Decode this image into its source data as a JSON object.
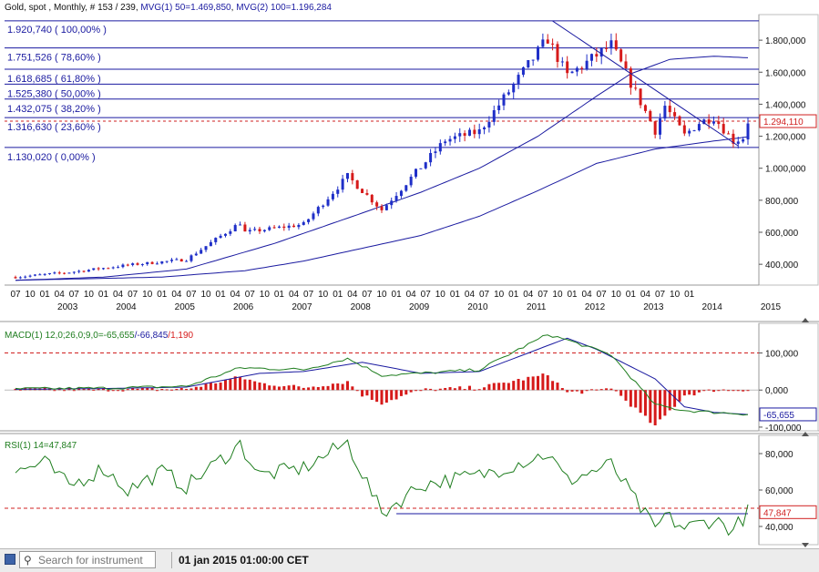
{
  "header": {
    "instrument": "Gold, spot",
    "timeframe": "Monthly",
    "bars": "# 153 / 239",
    "mvg1": "MVG(1) 50=1.469,850",
    "mvg2": "MVG(2) 100=1.196,284"
  },
  "colors": {
    "up_candle": "#1f2fc8",
    "down_candle": "#d61a1a",
    "line_blue": "#1a1aa0",
    "signal_green": "#1e7d1e",
    "hist_red": "#d61a1a",
    "dashed_red": "#d02020"
  },
  "chart_data": [
    {
      "type": "candlestick",
      "name": "price",
      "ylim": [
        270,
        1960
      ],
      "y_ticks": [
        {
          "v": 1800,
          "label": "1.800,000"
        },
        {
          "v": 1600,
          "label": "1.600,000"
        },
        {
          "v": 1400,
          "label": "1.400,000"
        },
        {
          "v": 1200,
          "label": "1.200,000"
        },
        {
          "v": 1000,
          "label": "1.000,000"
        },
        {
          "v": 800,
          "label": "800,000"
        },
        {
          "v": 600,
          "label": "600,000"
        },
        {
          "v": 400,
          "label": "400,000"
        }
      ],
      "last_price": {
        "value": 1294.11,
        "label": "1.294,110"
      },
      "fib_levels": [
        {
          "value": 1920.74,
          "label": "1.920,740 ( 100,00% )"
        },
        {
          "value": 1751.526,
          "label": "1.751,526 ( 78,60% )"
        },
        {
          "value": 1618.685,
          "label": "1.618,685 ( 61,80% )"
        },
        {
          "value": 1525.38,
          "label": "1.525,380 ( 50,00% )"
        },
        {
          "value": 1432.075,
          "label": "1.432,075 ( 38,20% )"
        },
        {
          "value": 1316.63,
          "label": "1.316,630 ( 23,60% )"
        },
        {
          "value": 1130.02,
          "label": "1.130,020 ( 0,00% )"
        }
      ],
      "anchors": [
        [
          "2002-07",
          320
        ],
        [
          "2003-06",
          350
        ],
        [
          "2004-06",
          395
        ],
        [
          "2005-06",
          430
        ],
        [
          "2006-05",
          660
        ],
        [
          "2006-06",
          600
        ],
        [
          "2007-06",
          650
        ],
        [
          "2008-03",
          950
        ],
        [
          "2008-10",
          740
        ],
        [
          "2009-11",
          1175
        ],
        [
          "2010-06",
          1230
        ],
        [
          "2011-08",
          1810
        ],
        [
          "2011-12",
          1575
        ],
        [
          "2012-09",
          1770
        ],
        [
          "2013-06",
          1235
        ],
        [
          "2013-08",
          1390
        ],
        [
          "2013-12",
          1205
        ],
        [
          "2014-03",
          1285
        ],
        [
          "2014-06",
          1320
        ],
        [
          "2014-10",
          1170
        ],
        [
          "2014-12",
          1190
        ],
        [
          "2015-01",
          1294
        ]
      ],
      "trendline": {
        "from": [
          "2011-09",
          1920
        ],
        "to": [
          "2014-11",
          1140
        ]
      },
      "mvg50": [
        [
          "2002-07",
          300
        ],
        [
          "2004-01",
          320
        ],
        [
          "2005-06",
          370
        ],
        [
          "2006-12",
          530
        ],
        [
          "2008-06",
          720
        ],
        [
          "2009-06",
          850
        ],
        [
          "2010-06",
          1000
        ],
        [
          "2011-06",
          1200
        ],
        [
          "2012-06",
          1450
        ],
        [
          "2013-01",
          1590
        ],
        [
          "2013-09",
          1680
        ],
        [
          "2014-06",
          1700
        ],
        [
          "2015-01",
          1690
        ]
      ],
      "mvg100": [
        [
          "2002-07",
          300
        ],
        [
          "2005-01",
          320
        ],
        [
          "2006-06",
          360
        ],
        [
          "2007-06",
          420
        ],
        [
          "2008-06",
          500
        ],
        [
          "2009-06",
          580
        ],
        [
          "2010-06",
          700
        ],
        [
          "2011-06",
          860
        ],
        [
          "2012-06",
          1030
        ],
        [
          "2013-06",
          1120
        ],
        [
          "2014-06",
          1170
        ],
        [
          "2015-01",
          1196
        ]
      ],
      "x_ticks": [
        "07",
        "10",
        "01",
        "04",
        "07",
        "10",
        "01",
        "04",
        "07",
        "10",
        "01",
        "04",
        "07",
        "10",
        "01",
        "04",
        "07",
        "10",
        "01",
        "04",
        "07",
        "10",
        "01",
        "04",
        "07",
        "10",
        "01",
        "04",
        "07",
        "10",
        "01",
        "04",
        "07",
        "10",
        "01",
        "04",
        "07",
        "10",
        "01",
        "04",
        "07",
        "10",
        "01",
        "04",
        "07",
        "10",
        "01"
      ],
      "x_years": [
        {
          "date": "2003-01",
          "label": "2003"
        },
        {
          "date": "2004-01",
          "label": "2004"
        },
        {
          "date": "2005-01",
          "label": "2005"
        },
        {
          "date": "2006-01",
          "label": "2006"
        },
        {
          "date": "2007-01",
          "label": "2007"
        },
        {
          "date": "2008-01",
          "label": "2008"
        },
        {
          "date": "2009-01",
          "label": "2009"
        },
        {
          "date": "2010-01",
          "label": "2010"
        },
        {
          "date": "2011-01",
          "label": "2011"
        },
        {
          "date": "2012-01",
          "label": "2012"
        },
        {
          "date": "2013-01",
          "label": "2013"
        },
        {
          "date": "2014-01",
          "label": "2014"
        },
        {
          "date": "2015-01",
          "label": "2015"
        }
      ]
    },
    {
      "type": "macd",
      "name": "macd",
      "label_prefix": "MACD(1) 12,0;26,0;9,0=",
      "label_macd": "-65,655",
      "label_sep": "/",
      "label_signal": "-66,845",
      "label_hist": "1,190",
      "ylim": [
        -110,
        180
      ],
      "y_ticks": [
        {
          "v": 100,
          "label": "100,000"
        },
        {
          "v": 0,
          "label": "0,000"
        },
        {
          "v": -100,
          "label": "-100,000"
        }
      ],
      "ref_line": 100,
      "last_value": {
        "value": -65.655,
        "label": "-65,655"
      },
      "macd_anchors": [
        [
          "2002-07",
          3
        ],
        [
          "2004-01",
          5
        ],
        [
          "2005-06",
          10
        ],
        [
          "2006-05",
          60
        ],
        [
          "2007-06",
          55
        ],
        [
          "2008-03",
          85
        ],
        [
          "2008-10",
          40
        ],
        [
          "2009-06",
          45
        ],
        [
          "2010-06",
          55
        ],
        [
          "2011-08",
          150
        ],
        [
          "2011-12",
          135
        ],
        [
          "2012-09",
          95
        ],
        [
          "2013-06",
          -40
        ],
        [
          "2013-12",
          -55
        ],
        [
          "2014-06",
          -60
        ],
        [
          "2015-01",
          -65
        ]
      ],
      "signal_anchors": [
        [
          "2002-07",
          2
        ],
        [
          "2004-01",
          4
        ],
        [
          "2005-06",
          8
        ],
        [
          "2006-09",
          45
        ],
        [
          "2007-06",
          50
        ],
        [
          "2008-06",
          75
        ],
        [
          "2009-06",
          45
        ],
        [
          "2010-06",
          50
        ],
        [
          "2011-12",
          140
        ],
        [
          "2012-06",
          110
        ],
        [
          "2013-06",
          30
        ],
        [
          "2013-12",
          -45
        ],
        [
          "2014-06",
          -60
        ],
        [
          "2015-01",
          -66
        ]
      ]
    },
    {
      "type": "line",
      "name": "rsi",
      "label": "RSI(1) 14=47,847",
      "ylim": [
        30,
        90
      ],
      "y_ticks": [
        {
          "v": 80,
          "label": "80,000"
        },
        {
          "v": 60,
          "label": "60,000"
        },
        {
          "v": 40,
          "label": "40,000"
        }
      ],
      "ref_line": 50,
      "last_value": {
        "value": 47.847,
        "label": "47,847"
      },
      "support": {
        "from": "2009-01",
        "to": "2015-01",
        "value": 47
      },
      "anchors": [
        [
          "2002-07",
          70
        ],
        [
          "2003-01",
          75
        ],
        [
          "2003-06",
          62
        ],
        [
          "2004-01",
          72
        ],
        [
          "2004-06",
          60
        ],
        [
          "2005-01",
          70
        ],
        [
          "2005-06",
          62
        ],
        [
          "2006-05",
          85
        ],
        [
          "2006-09",
          68
        ],
        [
          "2007-06",
          72
        ],
        [
          "2008-03",
          86
        ],
        [
          "2008-10",
          47
        ],
        [
          "2009-06",
          63
        ],
        [
          "2010-06",
          68
        ],
        [
          "2011-08",
          80
        ],
        [
          "2011-12",
          65
        ],
        [
          "2012-09",
          74
        ],
        [
          "2013-06",
          38
        ],
        [
          "2013-08",
          46
        ],
        [
          "2013-12",
          39
        ],
        [
          "2014-06",
          44
        ],
        [
          "2014-10",
          38
        ],
        [
          "2015-01",
          48
        ]
      ]
    }
  ],
  "toolbar": {
    "search_placeholder": "Search for instrument",
    "datetime": "01 jan 2015 01:00:00 CET"
  }
}
